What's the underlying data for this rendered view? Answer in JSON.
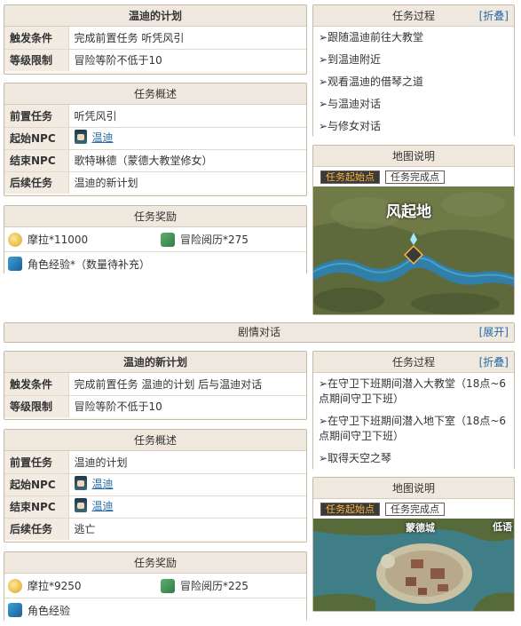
{
  "quest1": {
    "title": "温迪的计划",
    "trigger_label": "触发条件",
    "trigger_value": "完成前置任务 听凭风引",
    "level_label": "等级限制",
    "level_value": "冒险等阶不低于10",
    "overview_header": "任务概述",
    "prev_label": "前置任务",
    "prev_value": "听凭风引",
    "start_label": "起始NPC",
    "start_value": "温迪",
    "end_label": "结束NPC",
    "end_value": "歌特琳德（蒙德大教堂修女）",
    "next_label": "后续任务",
    "next_value": "温迪的新计划",
    "reward_header": "任务奖励",
    "reward_mora": "摩拉*11000",
    "reward_adv": "冒险阅历*275",
    "reward_exp": "角色经验*（数量待补充）",
    "process_header": "任务过程",
    "process_toggle": "[折叠]",
    "steps": [
      "➢跟随温迪前往大教堂",
      "➢到温迪附近",
      "➢观看温迪的借琴之道",
      "➢与温迪对话",
      "➢与修女对话"
    ],
    "map_header": "地图说明",
    "map_btn_start": "任务起始点",
    "map_btn_end": "任务完成点",
    "map_label": "风起地"
  },
  "story": {
    "label": "剧情对话",
    "toggle": "[展开]"
  },
  "quest2": {
    "title": "温迪的新计划",
    "trigger_label": "触发条件",
    "trigger_value": "完成前置任务 温迪的计划 后与温迪对话",
    "level_label": "等级限制",
    "level_value": "冒险等阶不低于10",
    "overview_header": "任务概述",
    "prev_label": "前置任务",
    "prev_value": "温迪的计划",
    "start_label": "起始NPC",
    "start_value": "温迪",
    "end_label": "结束NPC",
    "end_value": "温迪",
    "next_label": "后续任务",
    "next_value": "逃亡",
    "reward_header": "任务奖励",
    "reward_mora": "摩拉*9250",
    "reward_adv": "冒险阅历*225",
    "reward_exp": "角色经验",
    "process_header": "任务过程",
    "process_toggle": "[折叠]",
    "steps": [
      "➢在守卫下班期间潜入大教堂（18点~6点期间守卫下班）",
      "➢在守卫下班期间潜入地下室（18点~6点期间守卫下班）",
      "➢取得天空之琴"
    ],
    "map_header": "地图说明",
    "map_btn_start": "任务起始点",
    "map_btn_end": "任务完成点",
    "map_label": "蒙德城",
    "map_label2": "低语"
  },
  "colors": {
    "link": "#2a6aa8",
    "header_bg": "#efe8de",
    "border": "#c8b9a6",
    "active_btn_text": "#ffb43a"
  }
}
